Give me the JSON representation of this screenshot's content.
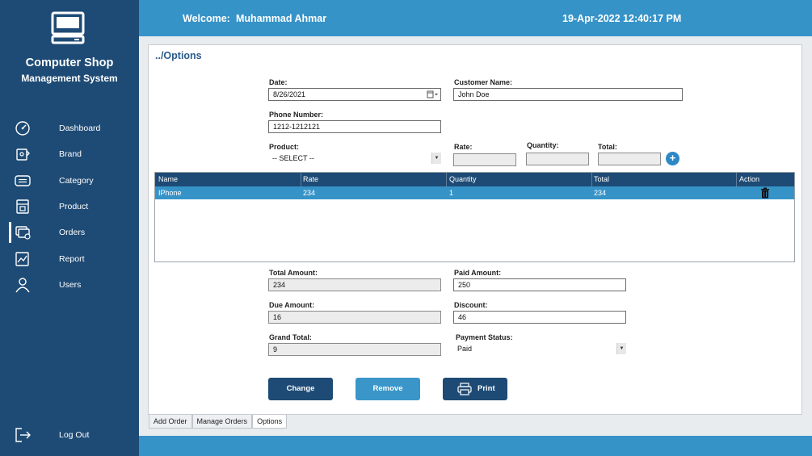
{
  "app": {
    "title_line1": "Computer Shop",
    "title_line2": "Management System"
  },
  "header": {
    "welcome_label": "Welcome:",
    "username": "Muhammad Ahmar",
    "datetime": "19-Apr-2022 12:40:17 PM"
  },
  "sidebar": {
    "items": [
      {
        "label": "Dashboard",
        "icon": "dashboard-icon"
      },
      {
        "label": "Brand",
        "icon": "brand-icon"
      },
      {
        "label": "Category",
        "icon": "category-icon"
      },
      {
        "label": "Product",
        "icon": "product-icon"
      },
      {
        "label": "Orders",
        "icon": "orders-icon"
      },
      {
        "label": "Report",
        "icon": "report-icon"
      },
      {
        "label": "Users",
        "icon": "user-icon"
      }
    ],
    "logout": "Log Out",
    "active": "Orders"
  },
  "breadcrumb": "../Options",
  "form": {
    "date_label": "Date:",
    "date_value": "8/26/2021",
    "customer_label": "Customer Name:",
    "customer_value": "John Doe",
    "phone_label": "Phone Number:",
    "phone_value": "1212-1212121",
    "product_label": "Product:",
    "product_value": "-- SELECT --",
    "rate_label": "Rate:",
    "quantity_label": "Quantity:",
    "total_label": "Total:"
  },
  "table": {
    "columns": [
      "Name",
      "Rate",
      "Quantity",
      "Total",
      "Action"
    ],
    "rows": [
      {
        "name": "IPhone",
        "rate": "234",
        "quantity": "1",
        "total": "234",
        "action_icon": "trash-icon"
      }
    ]
  },
  "summary": {
    "total_amount_label": "Total Amount:",
    "total_amount": "234",
    "paid_amount_label": "Paid Amount:",
    "paid_amount": "250",
    "due_amount_label": "Due Amount:",
    "due_amount": "16",
    "discount_label": "Discount:",
    "discount": "46",
    "grand_total_label": "Grand Total:",
    "grand_total": "9",
    "payment_status_label": "Payment Status:",
    "payment_status": "Paid"
  },
  "buttons": {
    "change": "Change",
    "remove": "Remove",
    "print": "Print"
  },
  "tabs": [
    "Add Order",
    "Manage Orders",
    "Options"
  ],
  "active_tab": "Options",
  "colors": {
    "sidebar": "#1e4b75",
    "accent": "#3693c8",
    "button_dark": "#1e4b75",
    "button_light": "#3a96c9"
  }
}
